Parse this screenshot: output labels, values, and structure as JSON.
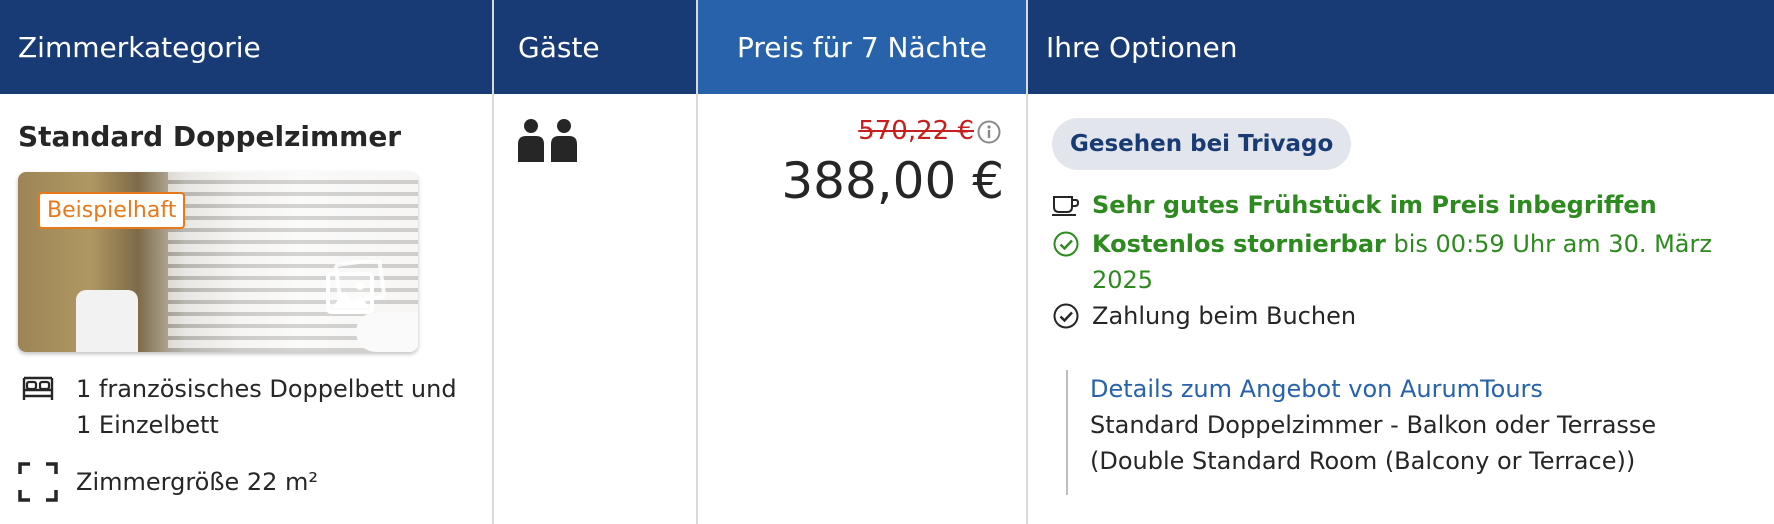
{
  "header": {
    "col_room": "Zimmerkategorie",
    "col_guests": "Gäste",
    "col_price": "Preis für 7 Nächte",
    "col_options": "Ihre Optionen"
  },
  "room": {
    "title": "Standard Doppelzimmer",
    "photo_badge": "Beispielhaft",
    "bed_line1": "1 französisches Doppelbett und",
    "bed_line2": "1 Einzelbett",
    "size": "Zimmergröße 22 m²"
  },
  "guests": {
    "count": 2,
    "icon": "two-persons-icon"
  },
  "price": {
    "old": "570,22 €",
    "new": "388,00 €"
  },
  "options": {
    "badge": "Gesehen bei Trivago",
    "breakfast": "Sehr gutes Frühstück im Preis inbegriffen",
    "cancel_bold": "Kostenlos stornierbar",
    "cancel_rest_1": " bis 00:59 Uhr am 30. März",
    "cancel_rest_2": "2025",
    "payment": "Zahlung beim Buchen",
    "offer_link": "Details zum Angebot von AurumTours",
    "offer_desc": "Standard Doppelzimmer - Balkon oder Terrasse (Double Standard Room (Balcony or Terrace))"
  },
  "colors": {
    "header_bg": "#183a75",
    "price_header_bg": "#2762aa",
    "green": "#2d8a1f",
    "strike_red": "#c71e1e",
    "badge_orange": "#e8791a"
  }
}
